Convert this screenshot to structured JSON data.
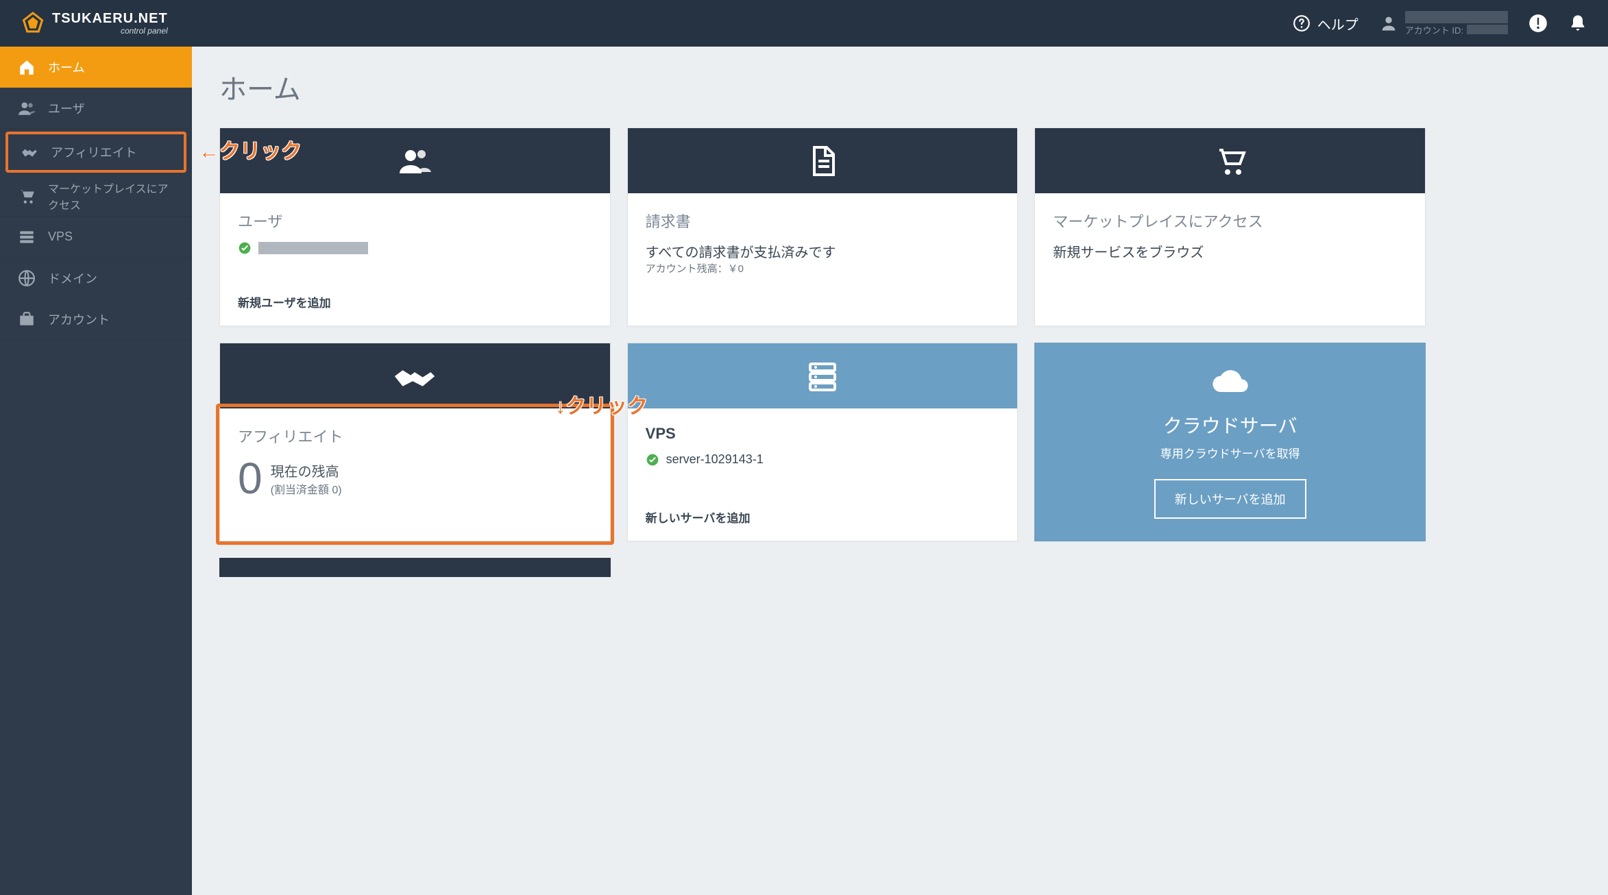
{
  "topbar": {
    "logo_main": "TSUKAERU.NET",
    "logo_sub": "control panel",
    "help": "ヘルプ",
    "account_id_label": "アカウント ID:"
  },
  "sidebar": {
    "items": [
      {
        "label": "ホーム"
      },
      {
        "label": "ユーザ"
      },
      {
        "label": "アフィリエイト"
      },
      {
        "label": "マーケットプレイスにアクセス"
      },
      {
        "label": "VPS"
      },
      {
        "label": "ドメイン"
      },
      {
        "label": "アカウント"
      }
    ]
  },
  "page": {
    "title": "ホーム"
  },
  "cards": {
    "user": {
      "title": "ユーザ",
      "footer": "新規ユーザを追加"
    },
    "invoice": {
      "title": "請求書",
      "line": "すべての請求書が支払済みです",
      "sub": "アカウント残高：￥0"
    },
    "market": {
      "title": "マーケットプレイスにアクセス",
      "line": "新規サービスをブラウズ"
    },
    "affiliate": {
      "title": "アフィリエイト",
      "zero": "0",
      "balance_label": "現在の残高",
      "balance_sub": "(割当済金額 0)"
    },
    "vps": {
      "title": "VPS",
      "server": "server-1029143-1",
      "footer": "新しいサーバを追加"
    },
    "cloud": {
      "title": "クラウドサーバ",
      "sub": "専用クラウドサーバを取得",
      "btn": "新しいサーバを追加"
    }
  },
  "annotations": {
    "side_click": "←クリック",
    "card_click": "↓クリック"
  }
}
